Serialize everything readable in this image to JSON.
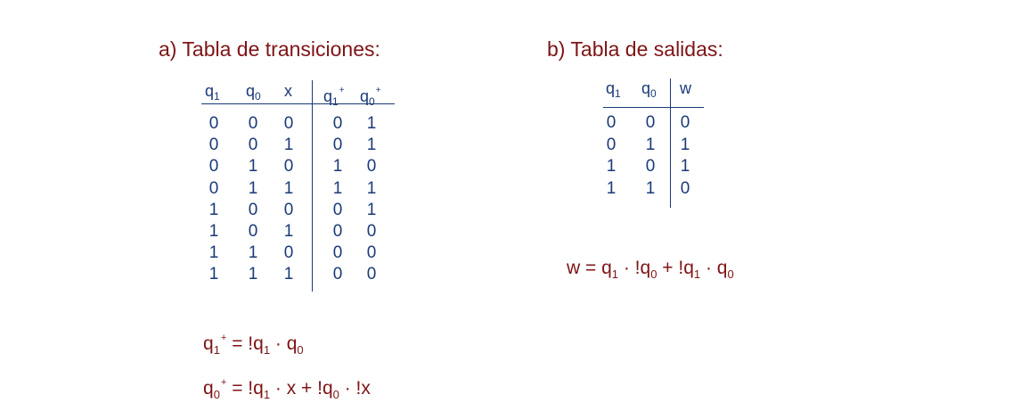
{
  "section_a": {
    "title": "a) Tabla de transiciones:",
    "headers": {
      "q1": "q",
      "q1_sub": "1",
      "q0": "q",
      "q0_sub": "0",
      "x": "x",
      "q1p": "q",
      "q1p_sub": "1",
      "q1p_sup": "+",
      "q0p": "q",
      "q0p_sub": "0",
      "q0p_sup": "+"
    },
    "rows": [
      [
        "0",
        "0",
        "0",
        "0",
        "1"
      ],
      [
        "0",
        "0",
        "1",
        "0",
        "1"
      ],
      [
        "0",
        "1",
        "0",
        "1",
        "0"
      ],
      [
        "0",
        "1",
        "1",
        "1",
        "1"
      ],
      [
        "1",
        "0",
        "0",
        "0",
        "1"
      ],
      [
        "1",
        "0",
        "1",
        "0",
        "0"
      ],
      [
        "1",
        "1",
        "0",
        "0",
        "0"
      ],
      [
        "1",
        "1",
        "1",
        "0",
        "0"
      ]
    ],
    "eq1": {
      "lhs": "q",
      "lhs_sub": "1",
      "lhs_sup": "+",
      "p1": " = !q",
      "p1_sub": "1",
      "p2": " · q",
      "p2_sub": "0"
    },
    "eq2": {
      "lhs": "q",
      "lhs_sub": "0",
      "lhs_sup": "+",
      "p1": " = !q",
      "p1_sub": "1",
      "p2": " · x + !q",
      "p2_sub": "0",
      "p3": " · !x"
    }
  },
  "section_b": {
    "title": "b) Tabla de salidas:",
    "headers": {
      "q1": "q",
      "q1_sub": "1",
      "q0": "q",
      "q0_sub": "0",
      "w": "w"
    },
    "rows": [
      [
        "0",
        "0",
        "0"
      ],
      [
        "0",
        "1",
        "1"
      ],
      [
        "1",
        "0",
        "1"
      ],
      [
        "1",
        "1",
        "0"
      ]
    ],
    "eq": {
      "p1": "w = q",
      "p1_sub": "1",
      "p2": " · !q",
      "p2_sub": "0",
      "p3": " + !q",
      "p3_sub": "1",
      "p4": " · q",
      "p4_sub": "0"
    }
  },
  "colors": {
    "title": "#7f1416",
    "table": "#1a3a78"
  }
}
